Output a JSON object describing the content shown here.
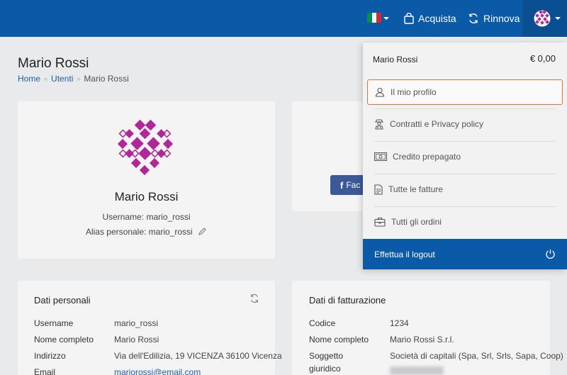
{
  "topbar": {
    "flag_colors": [
      "#009246",
      "#ffffff",
      "#ce2b37"
    ],
    "buy_label": "Acquista",
    "renew_label": "Rinnova",
    "accent": "#0a5aa8"
  },
  "page": {
    "title": "Mario Rossi",
    "breadcrumb": [
      "Home",
      "Utenti",
      "Mario Rossi"
    ]
  },
  "profile": {
    "name": "Mario Rossi",
    "username_line": "Username: mario_rossi",
    "alias_line": "Alias personale: mario_rossi",
    "avatar_color": "#b0279a"
  },
  "social": {
    "facebook_label": "Fac"
  },
  "personal": {
    "title": "Dati personali",
    "rows": [
      {
        "label": "Username",
        "value": "mario_rossi"
      },
      {
        "label": "Nome completo",
        "value": "Mario Rossi"
      },
      {
        "label": "Indirizzo",
        "value": "Via dell'Edilizia, 19 VICENZA 36100 Vicenza"
      },
      {
        "label": "Email",
        "value": "mariorossi@email.com"
      }
    ]
  },
  "billing": {
    "title": "Dati di fatturazione",
    "rows": [
      {
        "label": "Codice",
        "value": "1234"
      },
      {
        "label": "Nome completo",
        "value": "Mario Rossi S.r.l."
      },
      {
        "label_lines": [
          "Soggetto",
          "giuridico"
        ],
        "value": "Società di capitali (Spa, Srl, Srls, Sapa, Coop)"
      }
    ]
  },
  "dropdown": {
    "user_name": "Mario Rossi",
    "balance": "€ 0,00",
    "items": [
      {
        "label": "Il mio profilo",
        "icon": "user-icon"
      },
      {
        "label": "Contratti e Privacy policy",
        "icon": "contract-icon"
      },
      {
        "label": "Credito prepagato",
        "icon": "banknote-icon"
      },
      {
        "label": "Tutte le fatture",
        "icon": "document-icon"
      },
      {
        "label": "Tutti gli ordini",
        "icon": "briefcase-icon"
      }
    ],
    "logout_label": "Effettua il logout",
    "active_border_color": "#e8703a"
  }
}
